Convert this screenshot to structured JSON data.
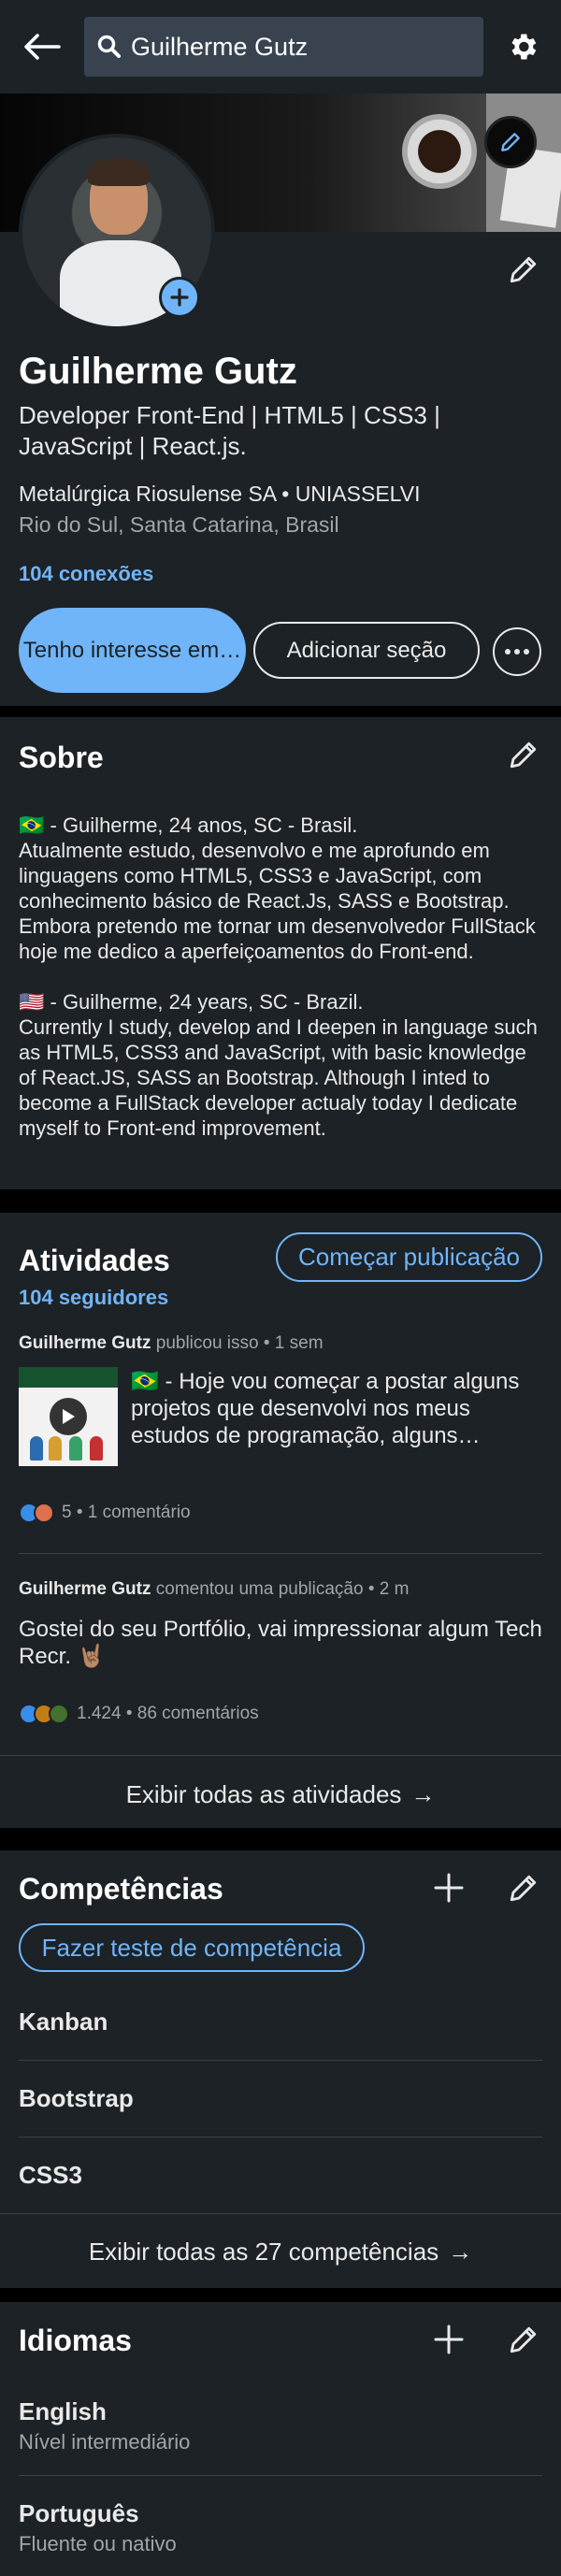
{
  "search": {
    "query": "Guilherme Gutz"
  },
  "profile": {
    "name": "Guilherme Gutz",
    "headline": "Developer Front-End | HTML5 | CSS3 | JavaScript | React.js.",
    "company": "Metalúrgica Riosulense SA • UNIASSELVI",
    "location": "Rio do Sul, Santa Catarina, Brasil",
    "connections": "104 conexões",
    "buttons": {
      "open_to": "Tenho interesse em…",
      "add_section": "Adicionar seção"
    }
  },
  "about": {
    "title": "Sobre",
    "text": "🇧🇷 -  Guilherme, 24 anos, SC - Brasil.\nAtualmente estudo, desenvolvo e me aprofundo em linguagens como HTML5, CSS3 e JavaScript, com conhecimento básico de React.Js, SASS e Bootstrap. Embora pretendo me tornar um desenvolvedor FullStack hoje me dedico a aperfeiçoamentos do Front-end.\n\n🇺🇸 - Guilherme, 24 years, SC - Brazil.\nCurrently I study, develop and I deepen in language such as HTML5, CSS3 and JavaScript, with basic knowledge of React.JS, SASS an Bootstrap. Although I inted to become a FullStack developer actualy today I dedicate myself to Front-end improvement."
  },
  "activity": {
    "title": "Atividades",
    "followers": "104 seguidores",
    "start_post": "Começar publicação",
    "post1": {
      "author": "Guilherme Gutz",
      "action": "publicou isso • 1 sem",
      "text": "🇧🇷 - Hoje vou começar a postar alguns projetos que desenvolvi nos meus estudos de programação, alguns…",
      "reactions": "5 • 1 comentário"
    },
    "post2": {
      "author": "Guilherme Gutz",
      "action": "comentou uma publicação • 2 m",
      "text": "Gostei do seu Portfólio, vai impressionar algum Tech Recr. 🤘🏽",
      "reactions": "1.424 • 86 comentários"
    },
    "show_all": "Exibir todas as atividades"
  },
  "skills": {
    "title": "Competências",
    "test_button": "Fazer teste de competência",
    "items": [
      "Kanban",
      "Bootstrap",
      "CSS3"
    ],
    "show_all": "Exibir todas as 27 competências"
  },
  "languages": {
    "title": "Idiomas",
    "items": [
      {
        "name": "English",
        "level": "Nível intermediário"
      },
      {
        "name": "Português",
        "level": "Fluente ou nativo"
      }
    ]
  },
  "colors": {
    "accent": "#70b5f9",
    "card": "#1d2226",
    "page": "#000000"
  }
}
